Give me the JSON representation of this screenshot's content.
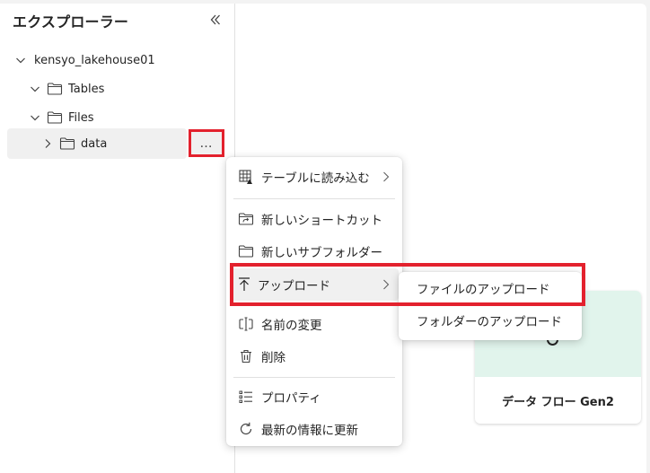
{
  "explorer": {
    "title": "エクスプローラー",
    "tree": {
      "root": "kensyo_lakehouse01",
      "tables": "Tables",
      "files": "Files",
      "data": "data"
    },
    "more_label": "…"
  },
  "context_menu": {
    "items": [
      {
        "label": "テーブルに読み込む",
        "icon": "table-load-icon"
      },
      {
        "label": "新しいショートカット",
        "icon": "shortcut-folder-icon"
      },
      {
        "label": "新しいサブフォルダー",
        "icon": "folder-icon"
      },
      {
        "label": "アップロード",
        "icon": "upload-arrow-icon"
      },
      {
        "label": "名前の変更",
        "icon": "rename-icon"
      },
      {
        "label": "削除",
        "icon": "trash-icon"
      },
      {
        "label": "プロパティ",
        "icon": "properties-list-icon"
      },
      {
        "label": "最新の情報に更新",
        "icon": "refresh-icon"
      }
    ]
  },
  "upload_submenu": {
    "items": [
      {
        "label": "ファイルのアップロード"
      },
      {
        "label": "フォルダーのアップロード"
      }
    ]
  },
  "card": {
    "label": "データ フロー Gen2"
  },
  "colors": {
    "highlight_red": "#e3212d",
    "card_green": "#e1f4ec"
  }
}
